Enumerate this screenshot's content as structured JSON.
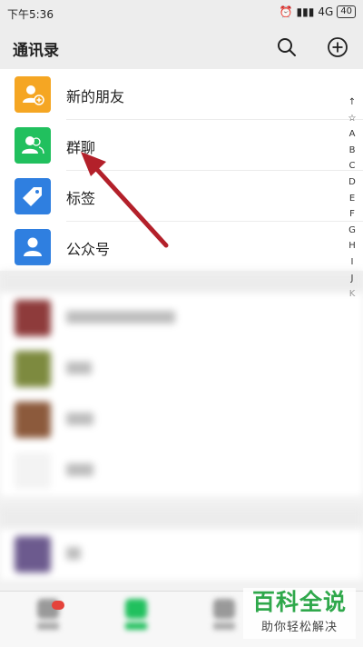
{
  "status_bar": {
    "time": "下午5:36",
    "network": "4G",
    "battery": "40"
  },
  "header": {
    "title": "通讯录",
    "search_icon": "search-icon",
    "add_icon": "plus-circle-icon"
  },
  "top_items": [
    {
      "label": "新的朋友",
      "icon": "person-add-icon",
      "color": "#f5a623"
    },
    {
      "label": "群聊",
      "icon": "group-icon",
      "color": "#21c05e"
    },
    {
      "label": "标签",
      "icon": "tag-icon",
      "color": "#2f7fe0"
    },
    {
      "label": "公众号",
      "icon": "person-icon",
      "color": "#2f7fe0"
    }
  ],
  "index_letters": [
    "↑",
    "☆",
    "A",
    "B",
    "C",
    "D",
    "E",
    "F",
    "G",
    "H",
    "I",
    "J",
    "K"
  ],
  "watermark": {
    "main": "百科全说",
    "sub": "助你轻松解决"
  },
  "colors": {
    "accent": "#21c05e",
    "annotation_arrow": "#b3202a"
  }
}
